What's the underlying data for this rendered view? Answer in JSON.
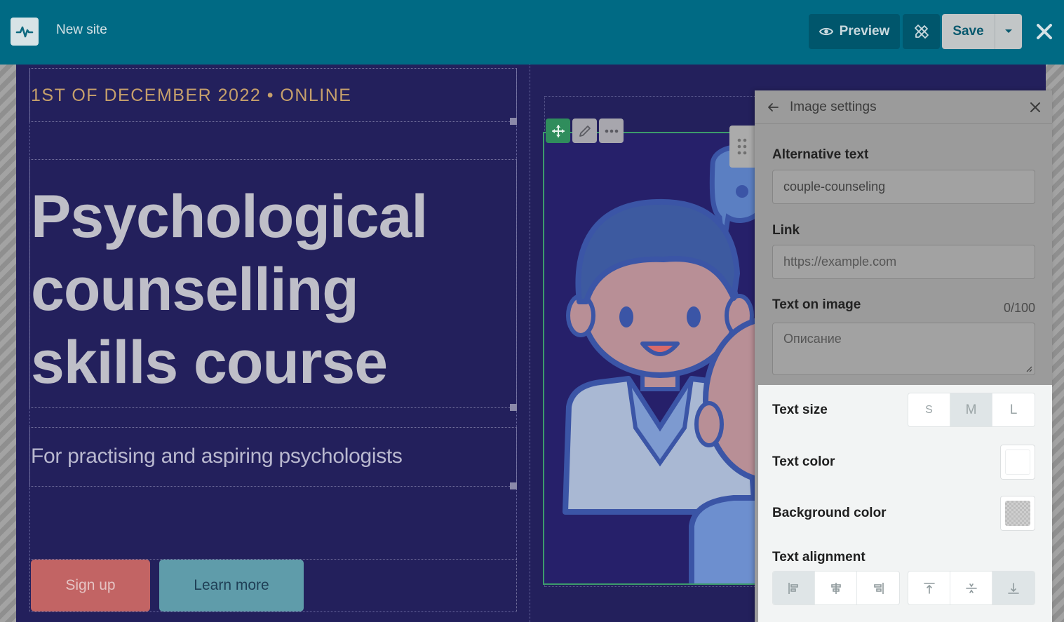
{
  "header": {
    "site_name": "New site",
    "preview_label": "Preview",
    "save_label": "Save"
  },
  "page": {
    "date_line": "1ST OF DECEMBER 2022 • ONLINE",
    "title_lines": [
      "Psychological",
      "counselling",
      "skills course"
    ],
    "subtitle": "For practising and aspiring psychologists",
    "signup_label": "Sign up",
    "learn_more_label": "Learn more"
  },
  "image_settings": {
    "title": "Image settings",
    "alt_label": "Alternative text",
    "alt_value": "couple-counseling",
    "link_label": "Link",
    "link_placeholder": "https://example.com",
    "text_on_image_label": "Text on image",
    "text_counter": "0/100",
    "text_placeholder": "Описание",
    "text_size_label": "Text size",
    "text_sizes": [
      "S",
      "M",
      "L"
    ],
    "text_size_selected": "M",
    "text_color_label": "Text color",
    "text_color": "#ffffff",
    "background_color_label": "Background color",
    "background_color": "transparent",
    "text_alignment_label": "Text alignment",
    "horizontal_align_selected": "left",
    "vertical_align_selected": "bottom"
  },
  "colors": {
    "topbar": "#006a84",
    "section_bg": "#23205c",
    "date_accent": "#c6a06b",
    "signup_button": "#c26464",
    "learn_more_button": "#5f9caa",
    "selection_outline": "#3c9b6c"
  },
  "icons": {
    "logo": "pulse-icon",
    "preview": "eye-icon",
    "design": "pencil-ruler-icon",
    "save_menu": "caret-down-icon",
    "close": "close-icon",
    "move": "move-icon",
    "edit": "pencil-icon",
    "more": "more-horizontal-icon",
    "drag": "drag-handle-icon",
    "back": "arrow-left-icon"
  }
}
